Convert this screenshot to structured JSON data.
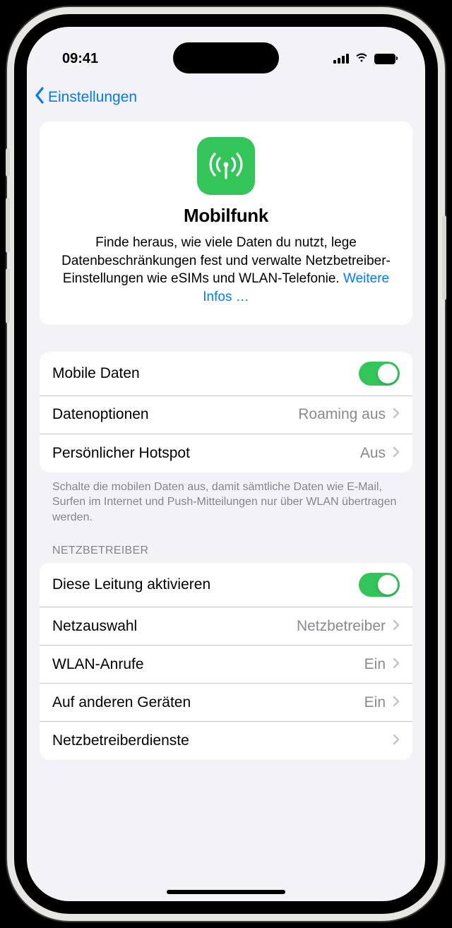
{
  "status": {
    "time": "09:41"
  },
  "nav": {
    "back": "Einstellungen"
  },
  "hero": {
    "title": "Mobilfunk",
    "desc": "Finde heraus, wie viele Daten du nutzt, lege Datenbeschränkungen fest und verwalte Netzbetreiber-Einstellungen wie eSIMs und WLAN-Telefonie. ",
    "link": "Weitere Infos …"
  },
  "group1": {
    "rows": [
      {
        "label": "Mobile Daten",
        "toggle": true
      },
      {
        "label": "Datenoptionen",
        "value": "Roaming aus"
      },
      {
        "label": "Persönlicher Hotspot",
        "value": "Aus"
      }
    ],
    "footer": "Schalte die mobilen Daten aus, damit sämtliche Daten wie E-Mail, Surfen im Internet und Push-Mitteilungen nur über WLAN übertragen werden."
  },
  "group2": {
    "header": "NETZBETREIBER",
    "rows": [
      {
        "label": "Diese Leitung aktivieren",
        "toggle": true
      },
      {
        "label": "Netzauswahl",
        "value": "Netzbetreiber"
      },
      {
        "label": "WLAN-Anrufe",
        "value": "Ein"
      },
      {
        "label": "Auf anderen Geräten",
        "value": "Ein"
      },
      {
        "label": "Netzbetreiberdienste",
        "value": ""
      }
    ]
  }
}
